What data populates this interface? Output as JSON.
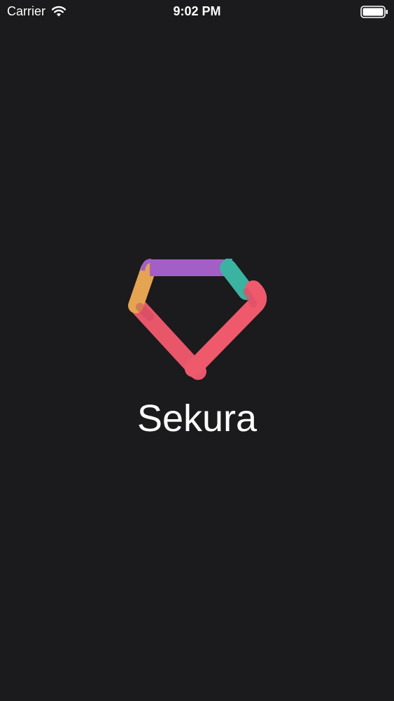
{
  "status_bar": {
    "carrier": "Carrier",
    "time": "9:02 PM",
    "wifi_icon": "wifi-icon",
    "battery_icon": "battery-full-icon"
  },
  "splash": {
    "app_name": "Sekura",
    "logo_icon": "gem-logo-icon",
    "logo_colors": [
      "#a45fc6",
      "#3bb3a1",
      "#e4a452",
      "#e8566a"
    ]
  },
  "colors": {
    "background": "#1b1a1c",
    "text": "#ffffff"
  }
}
